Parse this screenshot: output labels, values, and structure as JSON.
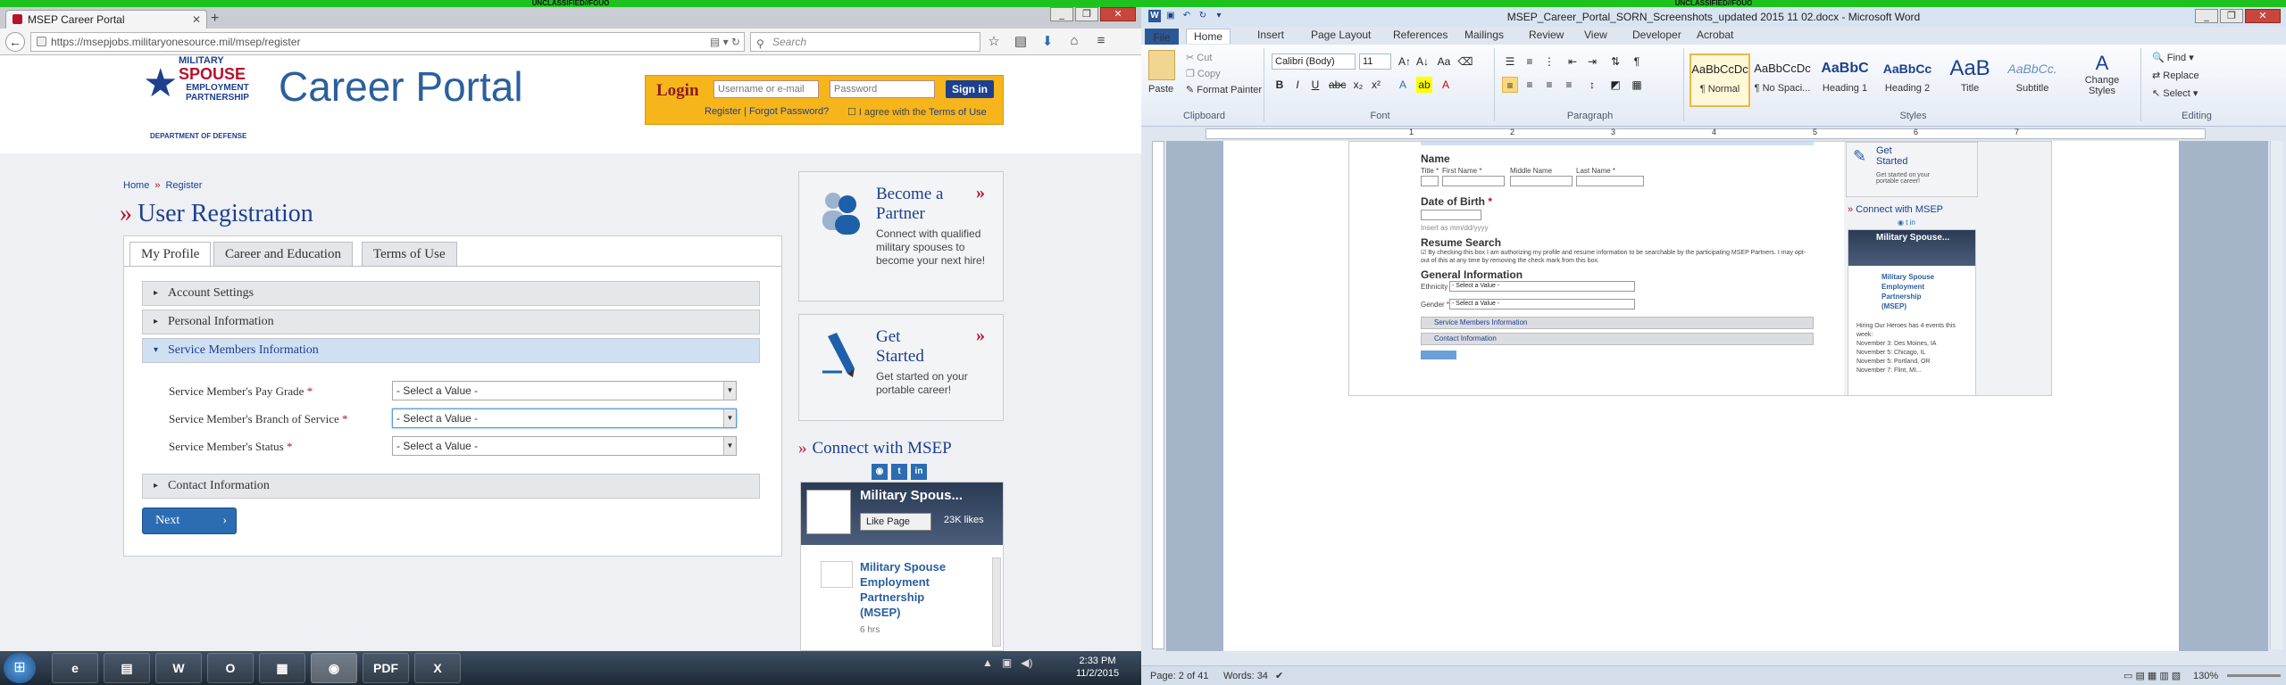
{
  "banner": {
    "left": "UNCLASSIFIED//FOUO",
    "right": "UNCLASSIFIED//FOUO"
  },
  "firefox": {
    "tab_title": "MSEP Career Portal",
    "url": "https://msepjobs.militaryonesource.mil/msep/register",
    "url_domain": "militaryonesource.mil",
    "search_placeholder": "Search"
  },
  "site": {
    "logo": {
      "line1": "MILITARY",
      "line2": "SPOUSE",
      "line3": "EMPLOYMENT",
      "line4": "PARTNERSHIP",
      "dept": "DEPARTMENT OF DEFENSE"
    },
    "portal_title": "Career Portal",
    "login": {
      "title": "Login",
      "user_placeholder": "Username or e-mail",
      "pass_placeholder": "Password",
      "signin": "Sign in",
      "register": "Register",
      "forgot": "Forgot Password?",
      "agree_prefix": "I agree with the",
      "terms": "Terms of Use"
    },
    "breadcrumb": {
      "home": "Home",
      "current": "Register"
    },
    "heading": "User Registration",
    "tabs": [
      "My Profile",
      "Career and Education",
      "Terms of Use"
    ],
    "accordion": {
      "account": "Account Settings",
      "personal": "Personal Information",
      "service": "Service Members Information",
      "contact": "Contact Information"
    },
    "fields": [
      {
        "label": "Service Member's Pay Grade",
        "value": "- Select a Value -"
      },
      {
        "label": "Service Member's Branch of Service",
        "value": "- Select a Value -"
      },
      {
        "label": "Service Member's Status",
        "value": "- Select a Value -"
      }
    ],
    "next": "Next",
    "promo_partner": {
      "title1": "Become a",
      "title2": "Partner",
      "text": "Connect with qualified military spouses to become your next hire!"
    },
    "promo_start": {
      "title1": "Get",
      "title2": "Started",
      "text": "Get started on your portable career!"
    },
    "connect": "Connect with MSEP",
    "fb": {
      "page_name": "Military Spous...",
      "like": "Like Page",
      "likes": "23K likes",
      "post_title": "Military Spouse Employment Partnership (MSEP)",
      "post_time": "6 hrs"
    }
  },
  "taskbar": {
    "apps": [
      "e",
      "▤",
      "W",
      "O",
      "▦",
      "◉",
      "PDF",
      "X"
    ],
    "time": "2:33 PM",
    "date": "11/2/2015"
  },
  "word": {
    "title": "MSEP_Career_Portal_SORN_Screenshots_updated 2015 11 02.docx - Microsoft Word",
    "menu": [
      "File",
      "Home",
      "Insert",
      "Page Layout",
      "References",
      "Mailings",
      "Review",
      "View",
      "Developer",
      "Acrobat"
    ],
    "clipboard": {
      "paste": "Paste",
      "cut": "Cut",
      "copy": "Copy",
      "format_painter": "Format Painter",
      "label": "Clipboard"
    },
    "font": {
      "name": "Calibri (Body)",
      "size": "11",
      "label": "Font"
    },
    "paragraph_label": "Paragraph",
    "styles": [
      {
        "preview": "AaBbCcDc",
        "name": "¶ Normal"
      },
      {
        "preview": "AaBbCcDc",
        "name": "¶ No Spaci..."
      },
      {
        "preview": "AaBbC",
        "name": "Heading 1"
      },
      {
        "preview": "AaBbCc",
        "name": "Heading 2"
      },
      {
        "preview": "AaB",
        "name": "Title"
      },
      {
        "preview": "AaBbCc.",
        "name": "Subtitle"
      }
    ],
    "styles_label": "Styles",
    "change_styles": "Change Styles",
    "editing": {
      "find": "Find",
      "replace": "Replace",
      "select": "Select",
      "label": "Editing"
    },
    "doc": {
      "name_heading": "Name",
      "name_fields": [
        "Title",
        "First Name",
        "Middle Name",
        "Last Name"
      ],
      "dob_heading": "Date of Birth",
      "dob_hint": "Insert as mm/dd/yyyy",
      "resume_heading": "Resume Search",
      "resume_text": "By checking this box I am authorizing my profile and resume information to be searchable by the participating MSEP Partners. I may opt-out of this at any time by removing the check mark from this box.",
      "general_heading": "General Information",
      "ethnicity": "Ethnicity",
      "gender": "Gender",
      "select_value": "- Select a Value -",
      "service_acc": "Service Members Information",
      "contact_acc": "Contact Information",
      "side_get_started": "Get Started",
      "side_get_text": "Get started on your portable career!",
      "side_connect": "Connect with MSEP",
      "side_fb": "Military Spouse...",
      "side_post": "Military Spouse Employment Partnership (MSEP)",
      "side_events": "Hiring Our Heroes has 4 events this week:",
      "side_list": [
        "November 3: Des Moines, IA",
        "November 5: Chicago, IL",
        "November 5: Portland, OR",
        "November 7: Flint, MI..."
      ]
    },
    "status": {
      "page": "Page: 2 of 41",
      "words": "Words: 34",
      "zoom": "130%"
    }
  }
}
